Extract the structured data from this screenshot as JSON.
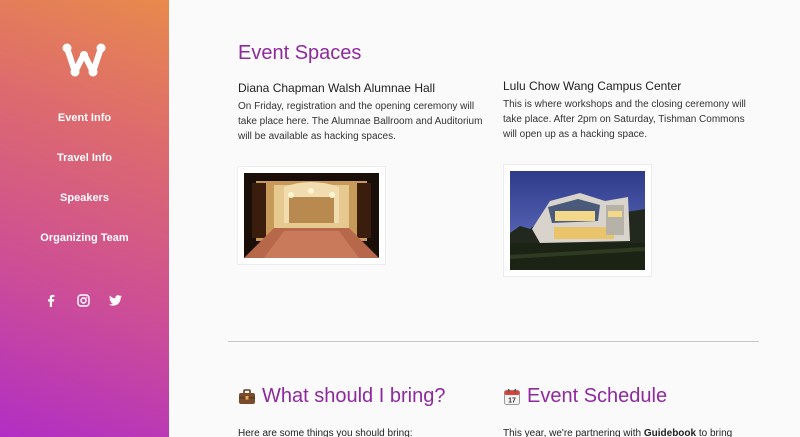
{
  "sidebar": {
    "nav": [
      {
        "label": "Event Info"
      },
      {
        "label": "Travel Info"
      },
      {
        "label": "Speakers"
      },
      {
        "label": "Organizing Team"
      }
    ],
    "social": [
      "facebook-icon",
      "instagram-icon",
      "twitter-icon"
    ]
  },
  "event_spaces": {
    "title": "Event Spaces",
    "venues": [
      {
        "name": "Diana Chapman Walsh Alumnae Hall",
        "desc": "On Friday, registration and the opening ceremony will take place here. The Alumnae Ballroom and Auditorium will be available as hacking spaces."
      },
      {
        "name": "Lulu Chow Wang Campus Center",
        "desc": "This is where workshops and the closing ceremony will take place. After 2pm on Saturday, Tishman Commons will open up as a hacking space."
      }
    ]
  },
  "bring": {
    "title": "What should I bring?",
    "intro": "Here are some things you should bring:"
  },
  "schedule": {
    "title": "Event Schedule",
    "intro_pre": "This year, we're partnering with ",
    "intro_bold": "Guidebook",
    "intro_post": " to bring"
  },
  "colors": {
    "accent": "#8e2a9e",
    "gradient_top": "#e88a4c",
    "gradient_bottom": "#b12ec4"
  }
}
